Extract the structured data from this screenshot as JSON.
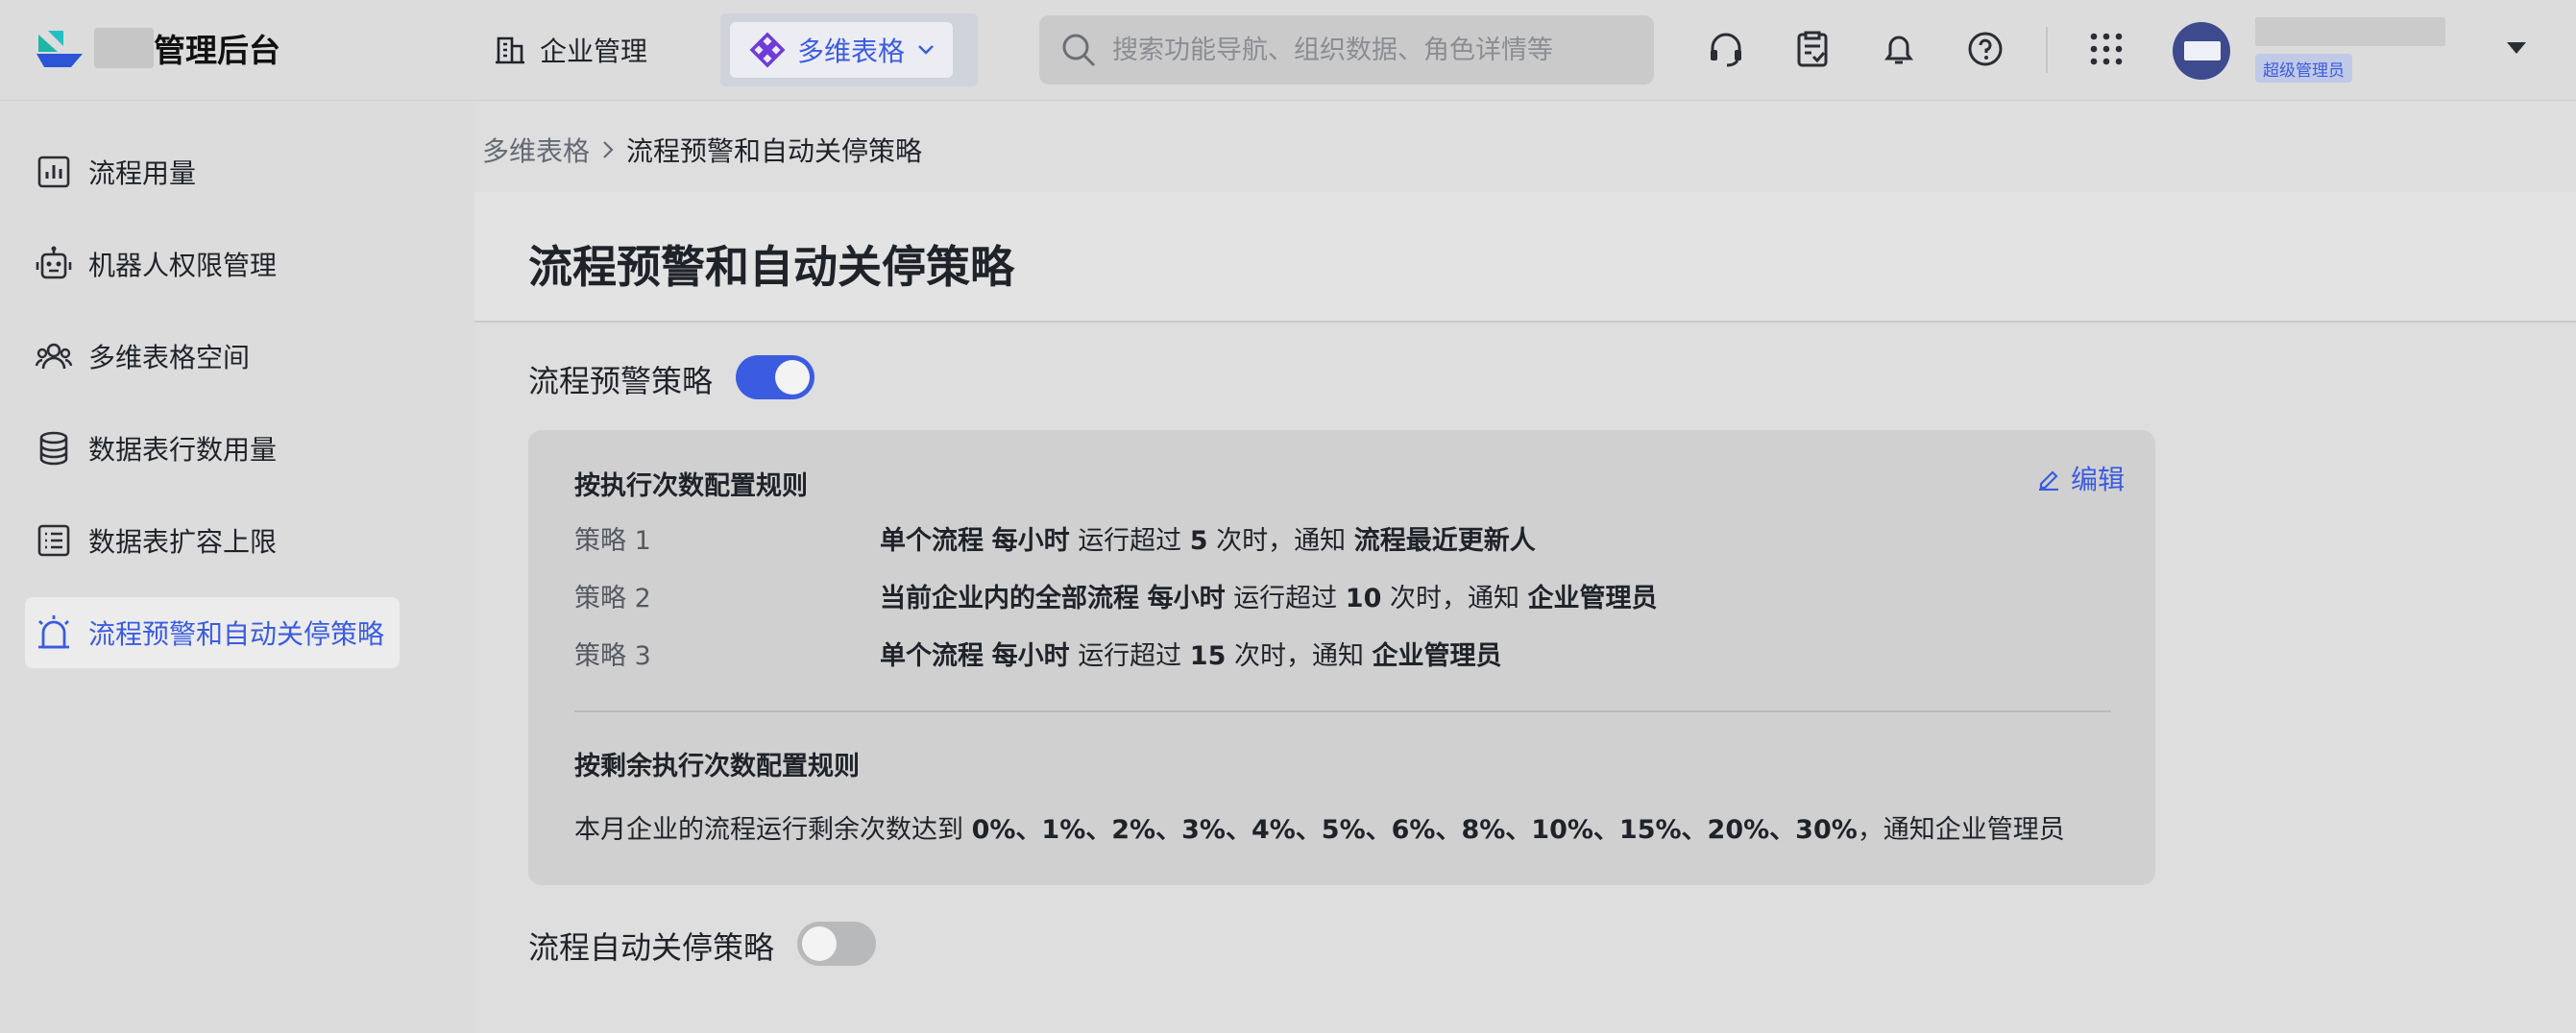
{
  "header": {
    "brand_suffix": "管理后台",
    "nav_enterprise": "企业管理",
    "nav_bitable": "多维表格",
    "search_placeholder": "搜索功能导航、组织数据、角色详情等",
    "role_badge": "超级管理员",
    "icons": [
      "headset-icon",
      "clipboard-check-icon",
      "bell-icon",
      "help-icon",
      "app-grid-icon"
    ]
  },
  "sidebar": {
    "items": [
      {
        "label": "流程用量",
        "icon": "bar-chart-icon"
      },
      {
        "label": "机器人权限管理",
        "icon": "robot-icon"
      },
      {
        "label": "多维表格空间",
        "icon": "users-icon"
      },
      {
        "label": "数据表行数用量",
        "icon": "database-icon"
      },
      {
        "label": "数据表扩容上限",
        "icon": "list-icon"
      },
      {
        "label": "流程预警和自动关停策略",
        "icon": "alarm-icon",
        "active": true
      }
    ]
  },
  "breadcrumb": {
    "parent": "多维表格",
    "current": "流程预警和自动关停策略"
  },
  "page": {
    "title": "流程预警和自动关停策略",
    "warning_policy": {
      "label": "流程预警策略",
      "enabled": true,
      "edit_label": "编辑",
      "by_count_heading": "按执行次数配置规则",
      "rules": [
        {
          "name": "策略 1",
          "scope": "单个流程",
          "period": "每小时",
          "pre": "运行超过",
          "count": "5",
          "mid": "次时，通知",
          "target": "流程最近更新人"
        },
        {
          "name": "策略 2",
          "scope": "当前企业内的全部流程",
          "period": "每小时",
          "pre": "运行超过",
          "count": "10",
          "mid": "次时，通知",
          "target": "企业管理员"
        },
        {
          "name": "策略 3",
          "scope": "单个流程",
          "period": "每小时",
          "pre": "运行超过",
          "count": "15",
          "mid": "次时，通知",
          "target": "企业管理员"
        }
      ],
      "by_remaining_heading": "按剩余执行次数配置规则",
      "remaining_prefix": "本月企业的流程运行剩余次数达到",
      "remaining_thresholds": "0%、1%、2%、3%、4%、5%、6%、8%、10%、15%、20%、30%",
      "remaining_suffix": "，通知企业管理员"
    },
    "auto_stop_policy": {
      "label": "流程自动关停策略",
      "enabled": false
    }
  },
  "colors": {
    "accent": "#3b5ce0",
    "background": "#dcdcdc"
  }
}
